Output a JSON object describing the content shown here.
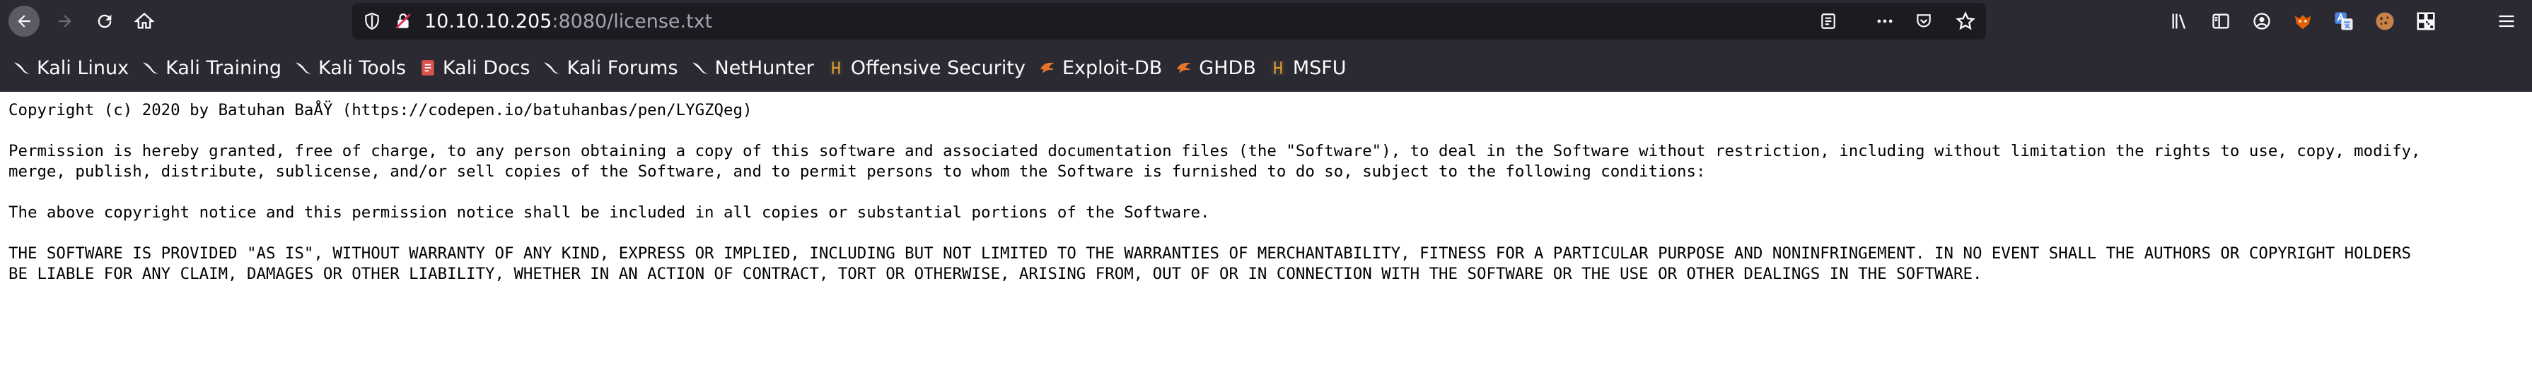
{
  "browser": {
    "url_host": "10.10.10.205",
    "url_rest": ":8080/license.txt",
    "bookmarks": [
      {
        "label": "Kali Linux",
        "icon": "kali-dragon-icon"
      },
      {
        "label": "Kali Training",
        "icon": "kali-dragon-icon"
      },
      {
        "label": "Kali Tools",
        "icon": "kali-dragon-icon"
      },
      {
        "label": "Kali Docs",
        "icon": "kali-docs-icon"
      },
      {
        "label": "Kali Forums",
        "icon": "kali-dragon-icon"
      },
      {
        "label": "NetHunter",
        "icon": "kali-dragon-icon"
      },
      {
        "label": "Offensive Security",
        "icon": "offsec-icon"
      },
      {
        "label": "Exploit-DB",
        "icon": "exploitdb-icon"
      },
      {
        "label": "GHDB",
        "icon": "exploitdb-icon"
      },
      {
        "label": "MSFU",
        "icon": "offsec-icon"
      }
    ]
  },
  "document": {
    "line1": "Copyright (c) 2020 by Batuhan BaÅŸ (https://codepen.io/batuhanbas/pen/LYGZQeg)",
    "line2": "",
    "line3": "Permission is hereby granted, free of charge, to any person obtaining a copy of this software and associated documentation files (the \"Software\"), to deal in the Software without restriction, including without limitation the rights to use, copy, modify,",
    "line4": "merge, publish, distribute, sublicense, and/or sell copies of the Software, and to permit persons to whom the Software is furnished to do so, subject to the following conditions:",
    "line5": "",
    "line6": "The above copyright notice and this permission notice shall be included in all copies or substantial portions of the Software.",
    "line7": "",
    "line8": "THE SOFTWARE IS PROVIDED \"AS IS\", WITHOUT WARRANTY OF ANY KIND, EXPRESS OR IMPLIED, INCLUDING BUT NOT LIMITED TO THE WARRANTIES OF MERCHANTABILITY, FITNESS FOR A PARTICULAR PURPOSE AND NONINFRINGEMENT. IN NO EVENT SHALL THE AUTHORS OR COPYRIGHT HOLDERS",
    "line9": "BE LIABLE FOR ANY CLAIM, DAMAGES OR OTHER LIABILITY, WHETHER IN AN ACTION OF CONTRACT, TORT OR OTHERWISE, ARISING FROM, OUT OF OR IN CONNECTION WITH THE SOFTWARE OR THE USE OR OTHER DEALINGS IN THE SOFTWARE."
  },
  "colors": {
    "chrome_bg": "#2b2a33",
    "urlbar_bg": "#1c1b22",
    "text_light": "#fbfbfe",
    "page_bg": "#ffffff"
  }
}
